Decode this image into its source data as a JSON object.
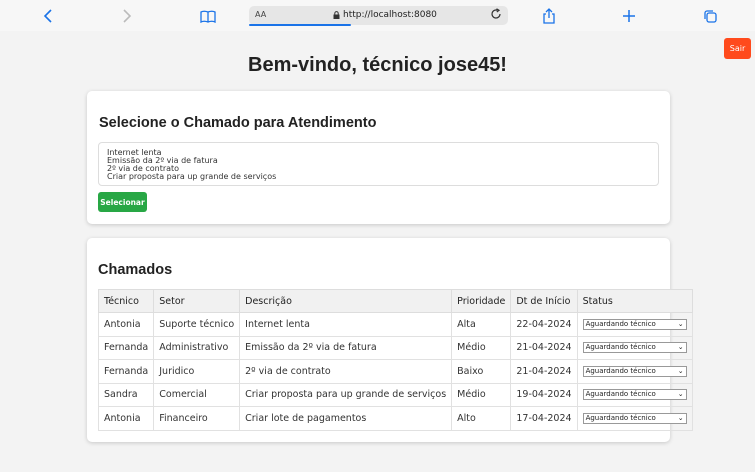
{
  "browser": {
    "aa_label": "AA",
    "url": "http://localhost:8080"
  },
  "header": {
    "logout_label": "Sair",
    "title": "Bem-vindo, técnico jose45!"
  },
  "select_section": {
    "heading": "Selecione o Chamado para Atendimento",
    "options": [
      "Internet lenta",
      "Emissão da 2º via de fatura",
      "2º via de contrato",
      "Criar proposta para up grande de serviços"
    ],
    "button_label": "Selecionar"
  },
  "table_section": {
    "heading": "Chamados",
    "columns": [
      "Técnico",
      "Setor",
      "Descrição",
      "Prioridade",
      "Dt de Início",
      "Status"
    ],
    "rows": [
      {
        "tecnico": "Antonia",
        "setor": "Suporte técnico",
        "descricao": "Internet lenta",
        "prioridade": "Alta",
        "inicio": "22-04-2024",
        "status": "Aguardando técnico"
      },
      {
        "tecnico": "Fernanda",
        "setor": "Administrativo",
        "descricao": "Emissão da 2º via de fatura",
        "prioridade": "Médio",
        "inicio": "21-04-2024",
        "status": "Aguardando técnico"
      },
      {
        "tecnico": "Fernanda",
        "setor": "Juridico",
        "descricao": "2º via de contrato",
        "prioridade": "Baixo",
        "inicio": "21-04-2024",
        "status": "Aguardando técnico"
      },
      {
        "tecnico": "Sandra",
        "setor": "Comercial",
        "descricao": "Criar proposta para up grande de serviços",
        "prioridade": "Médio",
        "inicio": "19-04-2024",
        "status": "Aguardando técnico"
      },
      {
        "tecnico": "Antonia",
        "setor": "Financeiro",
        "descricao": "Criar lote de pagamentos",
        "prioridade": "Alto",
        "inicio": "17-04-2024",
        "status": "Aguardando técnico"
      }
    ]
  },
  "colors": {
    "accent_blue": "#1a73e8",
    "logout_red": "#ff4a1c",
    "select_green": "#28a745"
  },
  "icons": [
    "back-icon",
    "forward-icon",
    "bookmarks-icon",
    "lock-icon",
    "reload-icon",
    "share-icon",
    "new-tab-icon",
    "tabs-icon"
  ]
}
